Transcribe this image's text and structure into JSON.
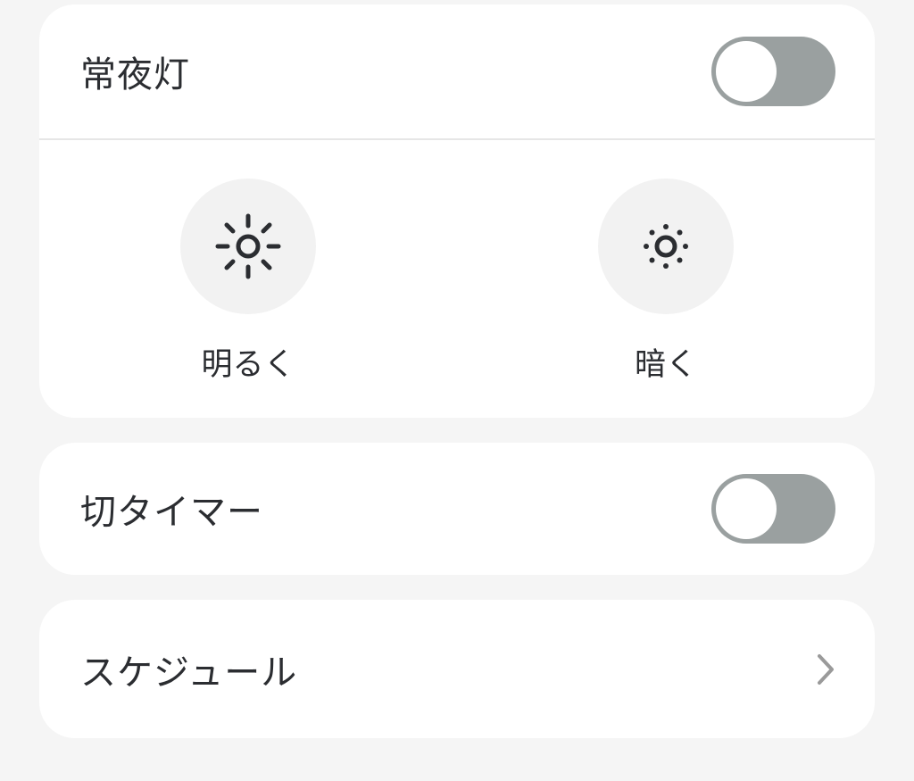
{
  "night_light": {
    "label": "常夜灯",
    "toggle_on": false,
    "brighter": {
      "label": "明るく",
      "icon": "sun-large-icon"
    },
    "dimmer": {
      "label": "暗く",
      "icon": "sun-small-icon"
    }
  },
  "off_timer": {
    "label": "切タイマー",
    "toggle_on": false
  },
  "schedule": {
    "label": "スケジュール",
    "icon": "chevron-right-icon"
  },
  "colors": {
    "background": "#f5f5f5",
    "card": "#ffffff",
    "toggle_off": "#9aa0a0",
    "text": "#2b2d31",
    "icon_circle": "#f2f2f2"
  }
}
